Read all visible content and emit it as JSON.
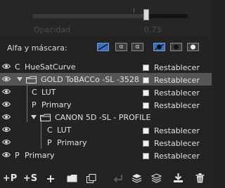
{
  "opacity": {
    "label": "Opacidad",
    "value": "0.73",
    "slider_fraction": 0.73
  },
  "alpha_mask": {
    "label": "Alfa y máscara:",
    "buttons": [
      {
        "icon": "alpha-invert-icon",
        "glyph": ""
      },
      {
        "icon": "alpha-icon",
        "glyph": "α"
      },
      {
        "icon": "alpha-icon",
        "glyph": "α"
      },
      {
        "icon": "mask-invert-icon",
        "glyph": ""
      },
      {
        "icon": "mask-circle-icon",
        "glyph": ""
      },
      {
        "icon": "mask-circle-icon",
        "glyph": ""
      }
    ]
  },
  "layers": [
    {
      "type_letter": "C",
      "name": "HueSatCurve",
      "reset": "Restablecer"
    },
    {
      "type_letter": "",
      "name": "GOLD ToBACCo -SL -3528",
      "reset": "Restablecer",
      "selected": true
    },
    {
      "type_letter": "C",
      "name": "LUT",
      "reset": "Restablecer"
    },
    {
      "type_letter": "P",
      "name": "Primary",
      "reset": "Restablecer"
    },
    {
      "type_letter": "",
      "name": "CANON 5D -SL - PROFILE",
      "reset": ""
    },
    {
      "type_letter": "C",
      "name": "LUT",
      "reset": "Restablecer"
    },
    {
      "type_letter": "P",
      "name": "Primary",
      "reset": "Restablecer"
    },
    {
      "type_letter": "P",
      "name": "Primary",
      "reset": "Restablecer"
    }
  ],
  "toolbar": {
    "add_primary": "+P",
    "add_secondary": "+S",
    "add": "+"
  }
}
